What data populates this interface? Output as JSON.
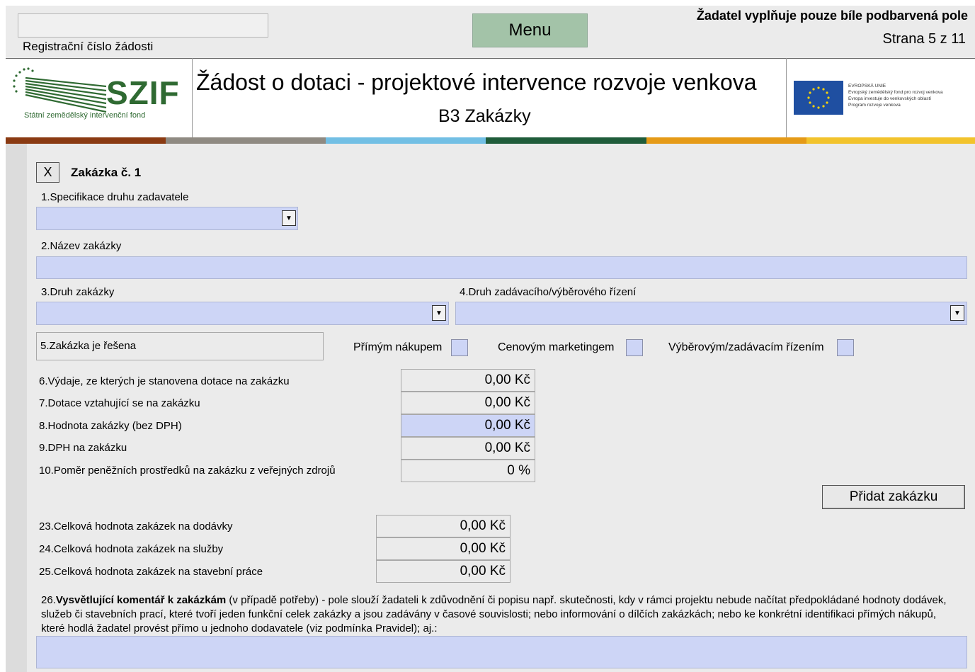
{
  "header": {
    "registration_label": "Registrační číslo žádosti",
    "menu_label": "Menu",
    "notice": "Žadatel vyplňuje pouze bíle podbarvená pole",
    "page_indicator": "Strana 5 z 11"
  },
  "title": {
    "logo_text": "SZIF",
    "logo_subtitle": "Státní zemědělský intervenční fond",
    "main": "Žádost o dotaci - projektové intervence rozvoje venkova",
    "section": "B3 Zakázky",
    "eu_lines": [
      "EVROPSKÁ UNIE",
      "Evropský zemědělský fond pro rozvoj venkova",
      "Evropa investuje do venkovských oblastí",
      "Program rozvoje venkova"
    ]
  },
  "colors": {
    "bar": [
      "#8a3a12",
      "#8f8a82",
      "#72bfe4",
      "#1f5c3a",
      "#e59a17",
      "#f2c32c"
    ],
    "field_fill": "#cdd5f6",
    "menu_fill": "#a3c3a8"
  },
  "form": {
    "remove_label": "X",
    "contract_title": "Zakázka č. 1",
    "q1": "1.Specifikace druhu zadavatele",
    "q2": "2.Název zakázky",
    "q3": "3.Druh zakázky",
    "q4": "4.Druh zadávacího/výběrového řízení",
    "q5": "5.Zakázka je řešena",
    "opt_direct": "Přímým nákupem",
    "opt_price": "Cenovým marketingem",
    "opt_tender": "Výběrovým/zadávacím řízením",
    "q6": "6.Výdaje, ze kterých je stanovena dotace na zakázku",
    "q7": "7.Dotace vztahující se na zakázku",
    "q8": "8.Hodnota zakázky (bez DPH)",
    "q9": "9.DPH na zakázku",
    "q10": "10.Poměr peněžních prostředků na zakázku z veřejných zdrojů",
    "v6": "0,00 Kč",
    "v7": "0,00 Kč",
    "v8": "0,00 Kč",
    "v9": "0,00 Kč",
    "v10": "0 %",
    "add_label": "Přidat zakázku",
    "q23": "23.Celková hodnota zakázek na dodávky",
    "q24": "24.Celková hodnota zakázek na služby",
    "q25": "25.Celková hodnota zakázek na stavební práce",
    "v23": "0,00 Kč",
    "v24": "0,00 Kč",
    "v25": "0,00 Kč",
    "q26_prefix": "26.",
    "q26_bold": "Vysvětlující komentář k zakázkám",
    "q26_rest": " (v případě potřeby) - pole slouží žadateli k zdůvodnění či popisu např. skutečnosti, kdy v rámci projektu nebude načítat předpokládané hodnoty dodávek, služeb či stavebních prací, které tvoří jeden funkční celek zakázky a jsou zadávány v časové souvislosti; nebo informování o dílčích zakázkách; nebo ke konkrétní identifikaci přímých nákupů, které hodlá žadatel provést přímo u jednoho dodavatele (viz podmínka Pravidel); aj.:"
  }
}
